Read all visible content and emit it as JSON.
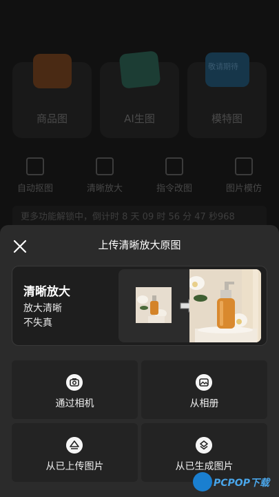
{
  "background": {
    "cards": [
      {
        "label": "商品图",
        "icon": "shopping-bag-icon"
      },
      {
        "label": "AI生图",
        "icon": "card-icon"
      },
      {
        "label": "模特图",
        "icon": "model-icon",
        "thumb_text": "敬请期待"
      }
    ],
    "tools": [
      {
        "label": "自动抠图",
        "icon": "cutout-icon"
      },
      {
        "label": "清晰放大",
        "icon": "enlarge-icon"
      },
      {
        "label": "指令改图",
        "icon": "edit-icon"
      },
      {
        "label": "图片模仿",
        "icon": "portrait-icon"
      }
    ],
    "countdown": "更多功能解锁中，倒计时 8 天 09 时 56 分 47 秒968"
  },
  "sheet": {
    "title": "上传清晰放大原图",
    "feature": {
      "title": "清晰放大",
      "subtitle_line1": "放大清晰",
      "subtitle_line2": "不失真"
    },
    "actions": [
      {
        "label": "通过相机",
        "icon": "camera-icon"
      },
      {
        "label": "从相册",
        "icon": "photo-album-icon"
      },
      {
        "label": "从已上传图片",
        "icon": "upload-cloud-icon"
      },
      {
        "label": "从已生成图片",
        "icon": "layers-icon"
      }
    ]
  },
  "watermark": {
    "text": "PCPOP下载"
  },
  "colors": {
    "sheet_bg": "#2b2b2b",
    "action_bg": "#232323",
    "accent_orange": "#d9892e"
  }
}
